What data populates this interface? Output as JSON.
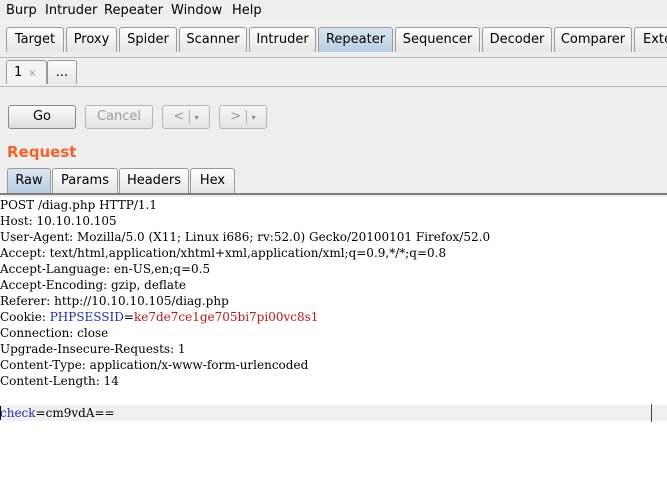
{
  "menu": [
    "Burp",
    "Intruder",
    "Repeater",
    "Window",
    "Help"
  ],
  "tool_tabs": [
    "Target",
    "Proxy",
    "Spider",
    "Scanner",
    "Intruder",
    "Repeater",
    "Sequencer",
    "Decoder",
    "Comparer",
    "Exte"
  ],
  "active_tool_tab": "Repeater",
  "repeater_tabs": {
    "first_label": "1",
    "close_glyph": "×",
    "more_label": "..."
  },
  "toolbar": {
    "go_label": "Go",
    "cancel_label": "Cancel",
    "back_glyph": "<",
    "forward_glyph": ">",
    "dropdown_glyph": "▾",
    "separator": "|"
  },
  "request": {
    "title": "Request",
    "tabs": [
      "Raw",
      "Params",
      "Headers",
      "Hex"
    ],
    "active_tab": "Raw"
  },
  "raw_request": {
    "line1": "POST /diag.php HTTP/1.1",
    "line2": "Host: 10.10.10.105",
    "line3": "User-Agent: Mozilla/5.0 (X11; Linux i686; rv:52.0) Gecko/20100101 Firefox/52.0",
    "line4": "Accept: text/html,application/xhtml+xml,application/xml;q=0.9,*/*;q=0.8",
    "line5": "Accept-Language: en-US,en;q=0.5",
    "line6": "Accept-Encoding: gzip, deflate",
    "line7": "Referer: http://10.10.10.105/diag.php",
    "cookie_prefix": "Cookie: ",
    "cookie_name": "PHPSESSID",
    "cookie_eq": "=",
    "cookie_value": "ke7de7ce1ge705bi7pi00vc8s1",
    "line9": "Connection: close",
    "line10": "Upgrade-Insecure-Requests: 1",
    "line11": "Content-Type: application/x-www-form-urlencoded",
    "line12": "Content-Length: 14",
    "body_param": "check",
    "body_eq": "=",
    "body_value": "cm9vdA=="
  },
  "colors": {
    "request_title": "#f0642c",
    "active_tab": "#b7cde2",
    "param_name": "#1d2fa8",
    "param_value": "#b01a1a"
  }
}
